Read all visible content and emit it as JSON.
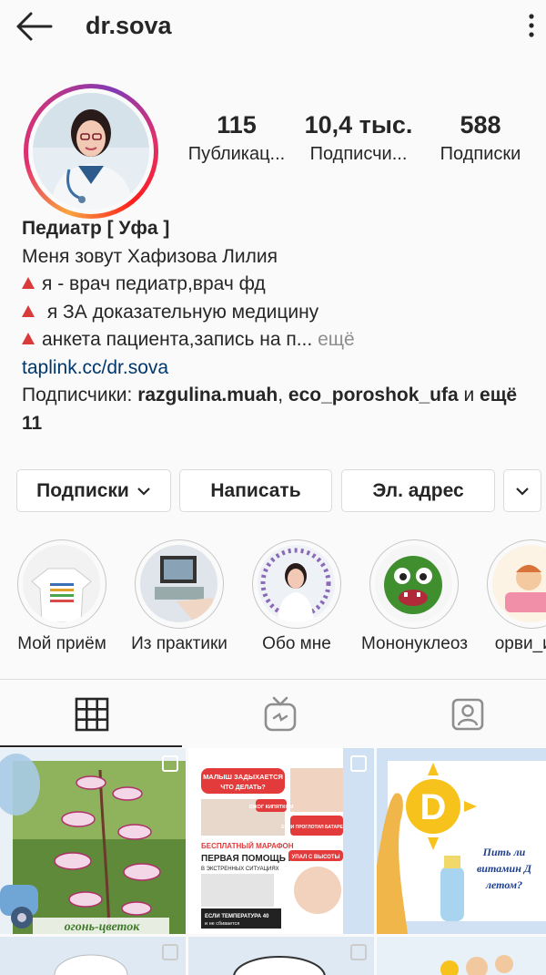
{
  "header": {
    "username": "dr.sova"
  },
  "stats": [
    {
      "value": "115",
      "label": "Публикац..."
    },
    {
      "value": "10,4 тыс.",
      "label": "Подписчи..."
    },
    {
      "value": "588",
      "label": "Подписки"
    }
  ],
  "bio": {
    "name": "Педиатр [ Уфа ]",
    "line1": "Меня зовут Хафизова Лилия",
    "line2": "я - врач педиатр,врач фд",
    "line3": "я ЗА доказательную медицину",
    "line4": "анкета пациента,запись на п...",
    "more": "ещё",
    "link": "taplink.cc/dr.sova",
    "followers_prefix": "Подписчики: ",
    "follower1": "razgulina.muah",
    "follower_sep": ", ",
    "follower2": "eco_poroshok_ufa",
    "followers_and": " и ",
    "followers_more": "ещё 11"
  },
  "actions": {
    "following": "Подписки",
    "message": "Написать",
    "email": "Эл. адрес"
  },
  "highlights": [
    {
      "label": "Мой приём"
    },
    {
      "label": "Из практики"
    },
    {
      "label": "Обо мне"
    },
    {
      "label": "Мононуклеоз"
    },
    {
      "label": "орви_и_г"
    }
  ],
  "posts": {
    "post1_caption": "огонь-цветок",
    "post2_title": "МАЛЫШ ЗАДЫХАЕТСЯ",
    "post2_sub": "ЧТО ДЕЛАТЬ?",
    "post2_l1": "ОЖОГ КИПЯТКОМ",
    "post2_l2": "ЕСЛИ ПРОГЛОТИЛ БАТАРЕЙКУ",
    "post2_l3": "БЕСПЛАТНЫЙ МАРАФОН",
    "post2_l4": "ПЕРВАЯ ПОМОЩЬ РЕБЕНКУ",
    "post2_l5": "В ЭКСТРЕННЫХ СИТУАЦИЯХ",
    "post2_l6": "УПАЛ С ВЫСОТЫ",
    "post2_l7": "ЕСЛИ ТЕМПЕРАТУРА 40",
    "post2_l8": "и не сбивается",
    "post3_letter": "D",
    "post3_q1": "Пить ли",
    "post3_q2": "витамин Д",
    "post3_q3": "летом?"
  }
}
